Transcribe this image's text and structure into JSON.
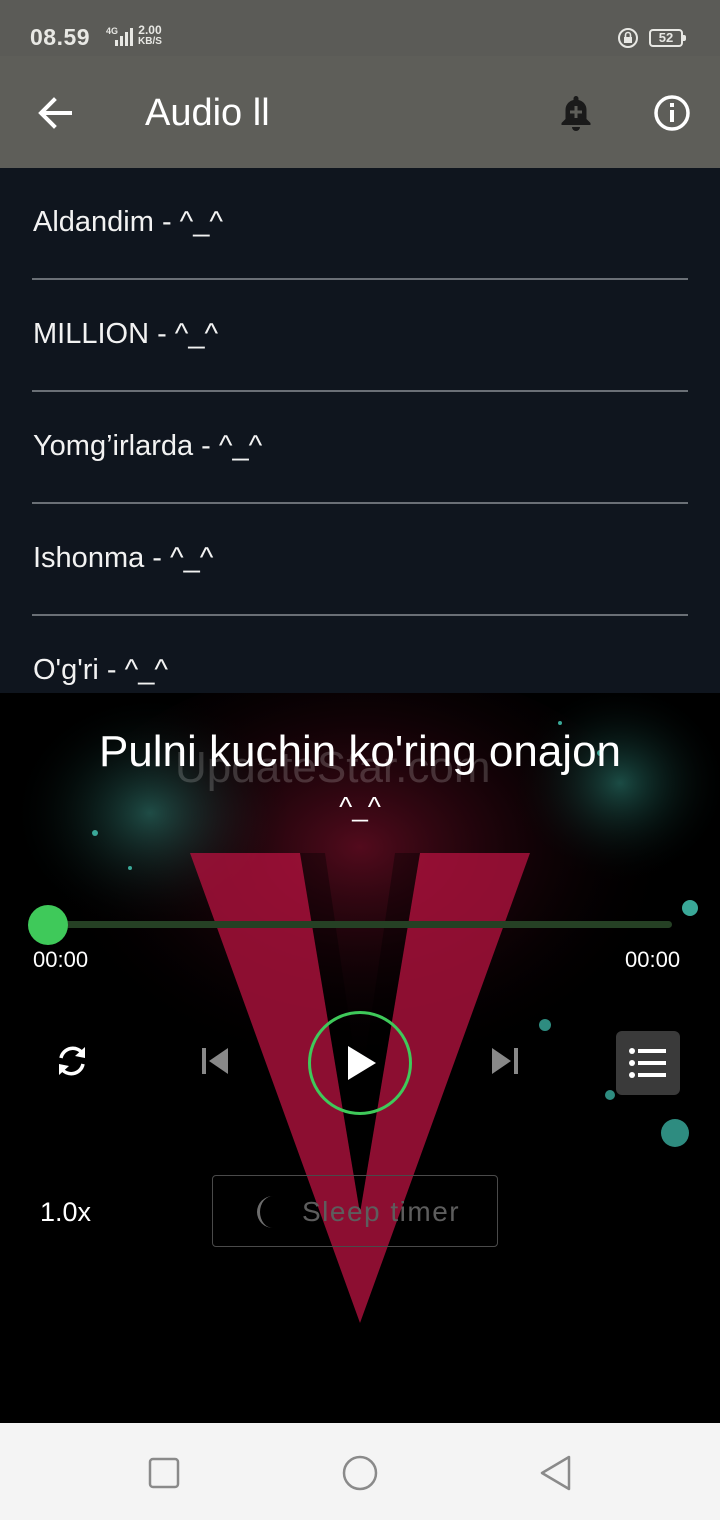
{
  "status_bar": {
    "time": "08.59",
    "network": "4G",
    "speed_value": "2.00",
    "speed_unit": "KB/S",
    "battery": "52"
  },
  "app_bar": {
    "title": "Audio ll"
  },
  "playlist": {
    "items": [
      {
        "title": "Aldandim - ^_^"
      },
      {
        "title": "MILLION - ^_^"
      },
      {
        "title": "Yomg’irlarda - ^_^"
      },
      {
        "title": "Ishonma - ^_^"
      },
      {
        "title": "O'g'ri - ^_^"
      }
    ]
  },
  "player": {
    "title": "Pulni kuchin ko'ring onajon",
    "artist": "^_^",
    "watermark": "UpdateStar.com",
    "progress": 0,
    "current_time": "00:00",
    "total_time": "00:00",
    "speed": "1.0x",
    "sleep_timer_label": "Sleep timer",
    "accent_color": "#3fc95a"
  }
}
